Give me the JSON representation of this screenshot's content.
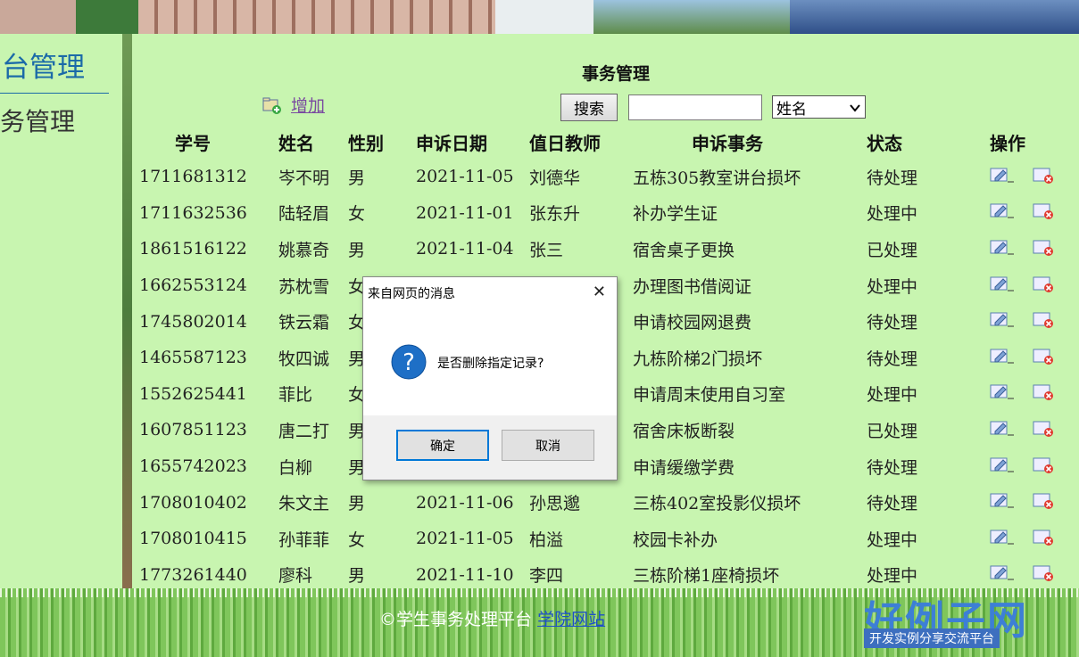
{
  "sidebar": {
    "title": "台管理",
    "item": "务管理"
  },
  "page": {
    "title": "事务管理"
  },
  "toolbar": {
    "add_label": "增加",
    "search_label": "搜索",
    "search_value": "",
    "select_value": "姓名"
  },
  "table": {
    "headers": [
      "学号",
      "姓名",
      "性别",
      "申诉日期",
      "值日教师",
      "申诉事务",
      "状态",
      "操作"
    ],
    "rows": [
      [
        "1711681312",
        "岑不明",
        "男",
        "2021-11-05",
        "刘德华",
        "五栋305教室讲台损坏",
        "待处理"
      ],
      [
        "1711632536",
        "陆轻眉",
        "女",
        "2021-11-01",
        "张东升",
        "补办学生证",
        "处理中"
      ],
      [
        "1861516122",
        "姚慕奇",
        "男",
        "2021-11-04",
        "张三",
        "宿舍桌子更换",
        "已处理"
      ],
      [
        "1662553124",
        "苏枕雪",
        "女",
        "",
        "",
        "办理图书借阅证",
        "处理中"
      ],
      [
        "1745802014",
        "铁云霜",
        "女",
        "",
        "",
        "申请校园网退费",
        "待处理"
      ],
      [
        "1465587123",
        "牧四诚",
        "男",
        "",
        "",
        "九栋阶梯2门损坏",
        "待处理"
      ],
      [
        "1552625441",
        "菲比",
        "女",
        "",
        "",
        "申请周末使用自习室",
        "处理中"
      ],
      [
        "1607851123",
        "唐二打",
        "男",
        "",
        "",
        "宿舍床板断裂",
        "已处理"
      ],
      [
        "1655742023",
        "白柳",
        "男",
        "",
        "",
        "申请缓缴学费",
        "待处理"
      ],
      [
        "1708010402",
        "朱文主",
        "男",
        "2021-11-06",
        "孙思邈",
        "三栋402室投影仪损坏",
        "待处理"
      ],
      [
        "1708010415",
        "孙菲菲",
        "女",
        "2021-11-05",
        "柏溢",
        "校园卡补办",
        "处理中"
      ],
      [
        "1773261440",
        "廖科",
        "男",
        "2021-11-10",
        "李四",
        "三栋阶梯1座椅损坏",
        "处理中"
      ]
    ]
  },
  "footer": {
    "copyright": "©学生事务处理平台",
    "link": "学院网站"
  },
  "watermark": {
    "logo": "好例子网",
    "slogan": "开发实例分享交流平台"
  },
  "dialog": {
    "title": "来自网页的消息",
    "close": "✕",
    "message": "是否删除指定记录?",
    "ok": "确定",
    "cancel": "取消"
  }
}
